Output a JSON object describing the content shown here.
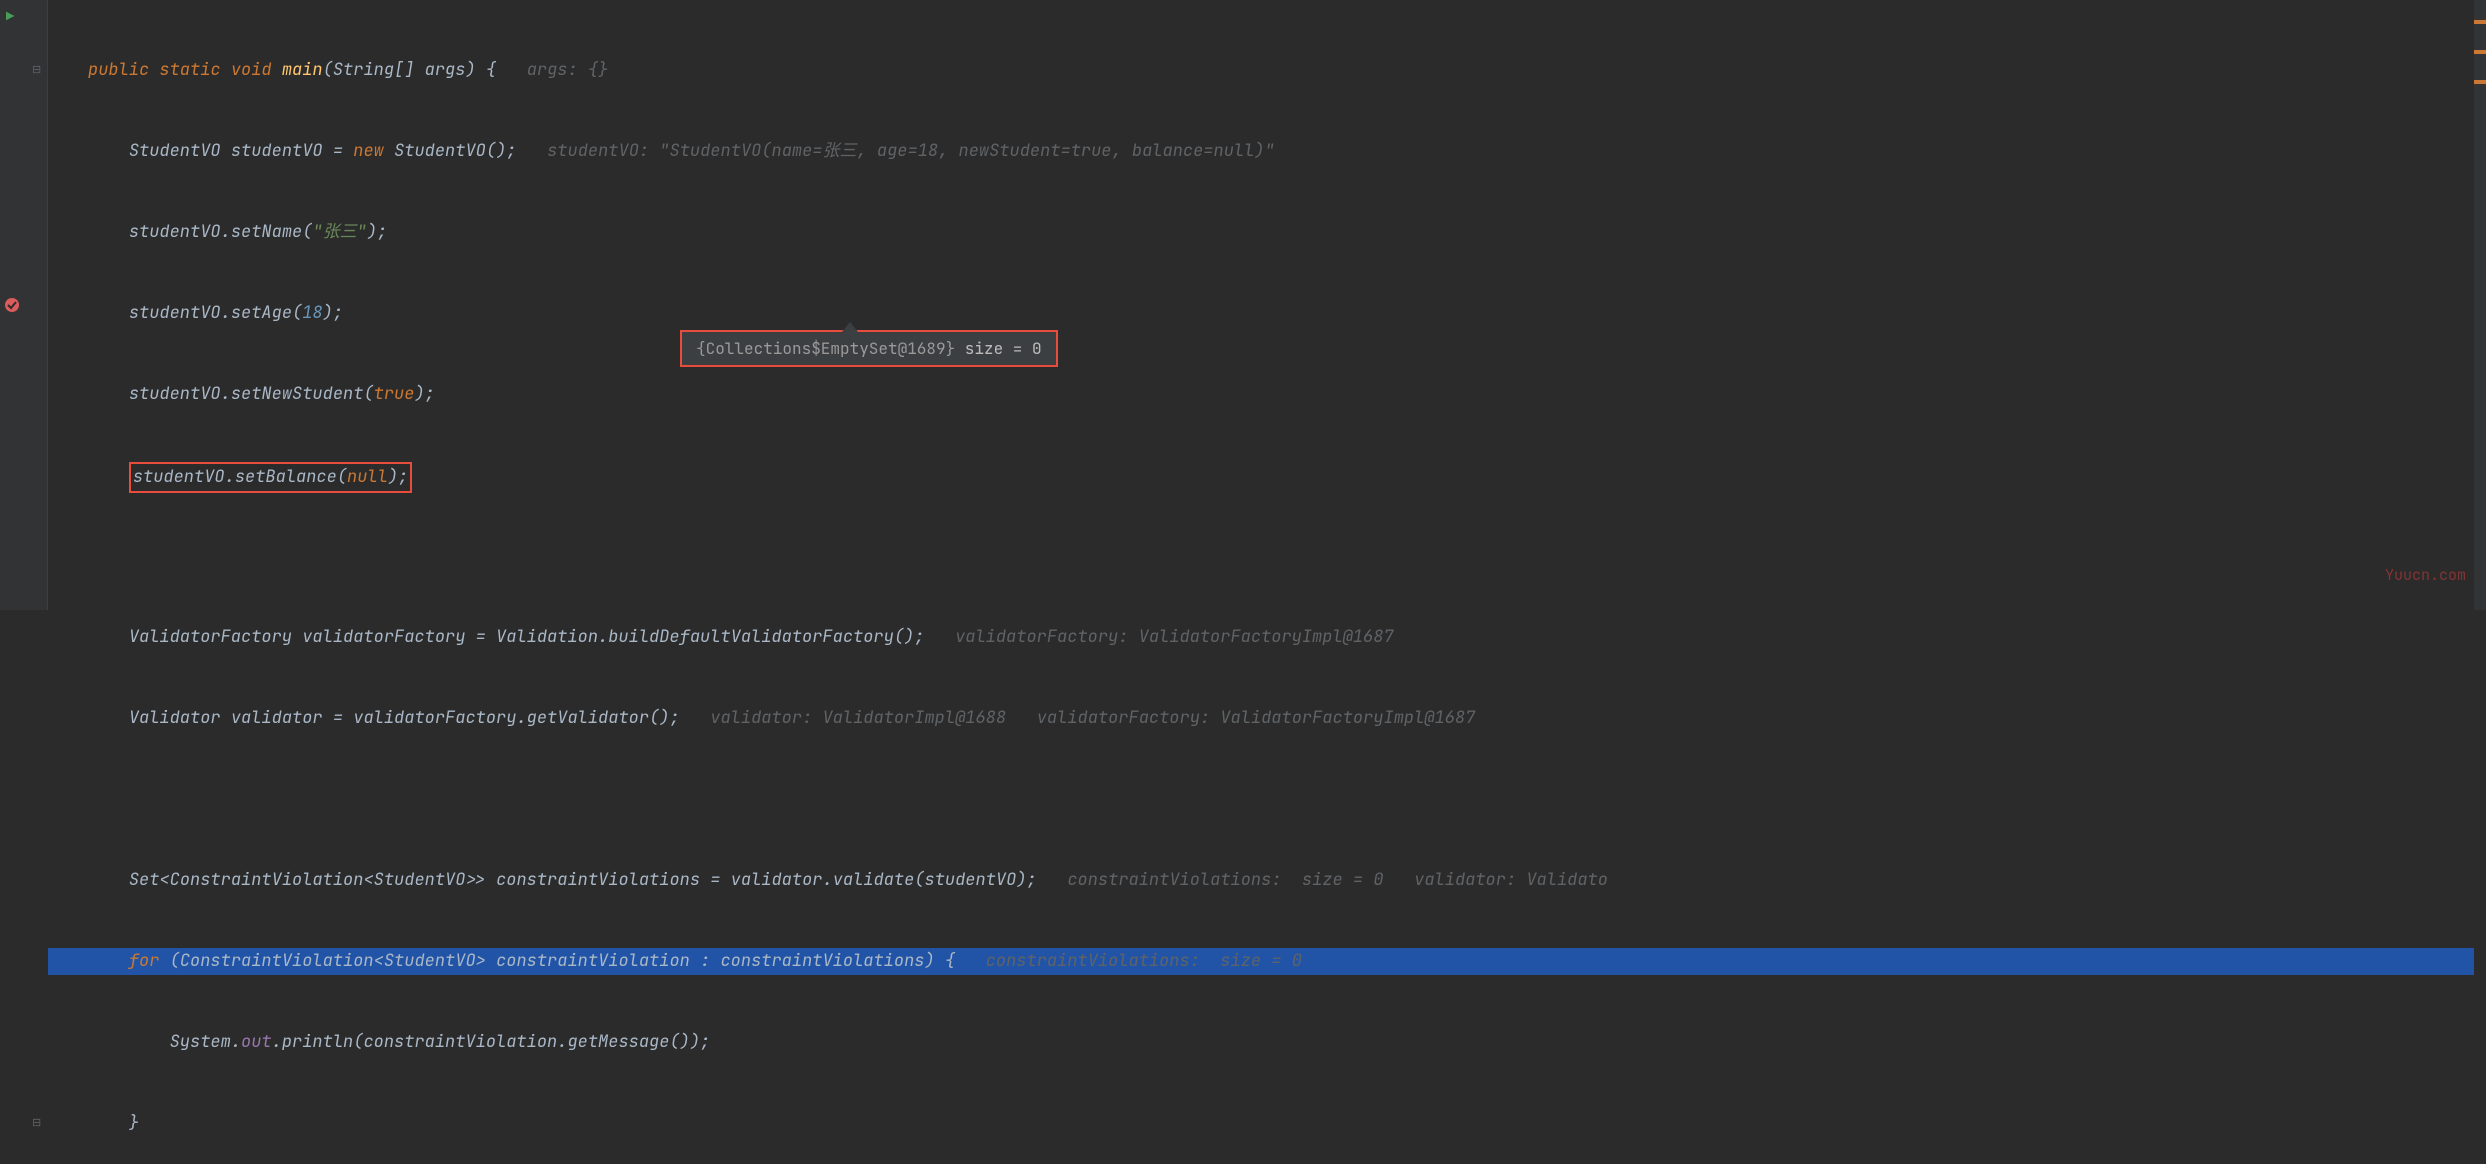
{
  "code": {
    "kw_public": "public",
    "kw_static": "static",
    "kw_void": "void",
    "method_main": "main",
    "type_string_arr": "String[]",
    "param_args": "args",
    "hint_args": "args: {}",
    "type_studentvo": "StudentVO",
    "var_studentvo": "studentVO",
    "kw_new": "new",
    "hint_studentvo": "studentVO: \"StudentVO(name=张三, age=18, newStudent=true, balance=null)\"",
    "call_setname": "setName",
    "str_name": "\"张三\"",
    "call_setage": "setAge",
    "num_18": "18",
    "call_setnewstudent": "setNewStudent",
    "kw_true": "true",
    "call_setbalance": "setBalance",
    "kw_null": "null",
    "type_validatorfactory": "ValidatorFactory",
    "var_validatorfactory": "validatorFactory",
    "type_validation": "Validation",
    "static_buildfactory": "buildDefaultValidatorFactory",
    "hint_validatorfactory": "validatorFactory: ValidatorFactoryImpl@1687",
    "type_validator": "Validator",
    "var_validator": "validator",
    "call_getvalidator": "getValidator",
    "hint_validator1": "validator: ValidatorImpl@1688",
    "hint_validator2": "validatorFactory: ValidatorFactoryImpl@1687",
    "type_set": "Set",
    "type_cv": "ConstraintViolation",
    "var_cvs": "constraintViolations",
    "call_validate": "validate",
    "hint_cvs": "constraintViolations:  size = 0",
    "hint_validator3": "validator: Validato",
    "kw_for": "for",
    "var_cv": "constraintViolation",
    "hint_for": "constraintViolations:  size = 0",
    "type_system": "System",
    "field_out": "out",
    "call_println": "println",
    "call_getmessage": "getMessage"
  },
  "tooltip": {
    "prefix": "{Collections$EmptySet@1689}",
    "suffix": "  size = 0"
  },
  "watermark": "Yuucn.com"
}
